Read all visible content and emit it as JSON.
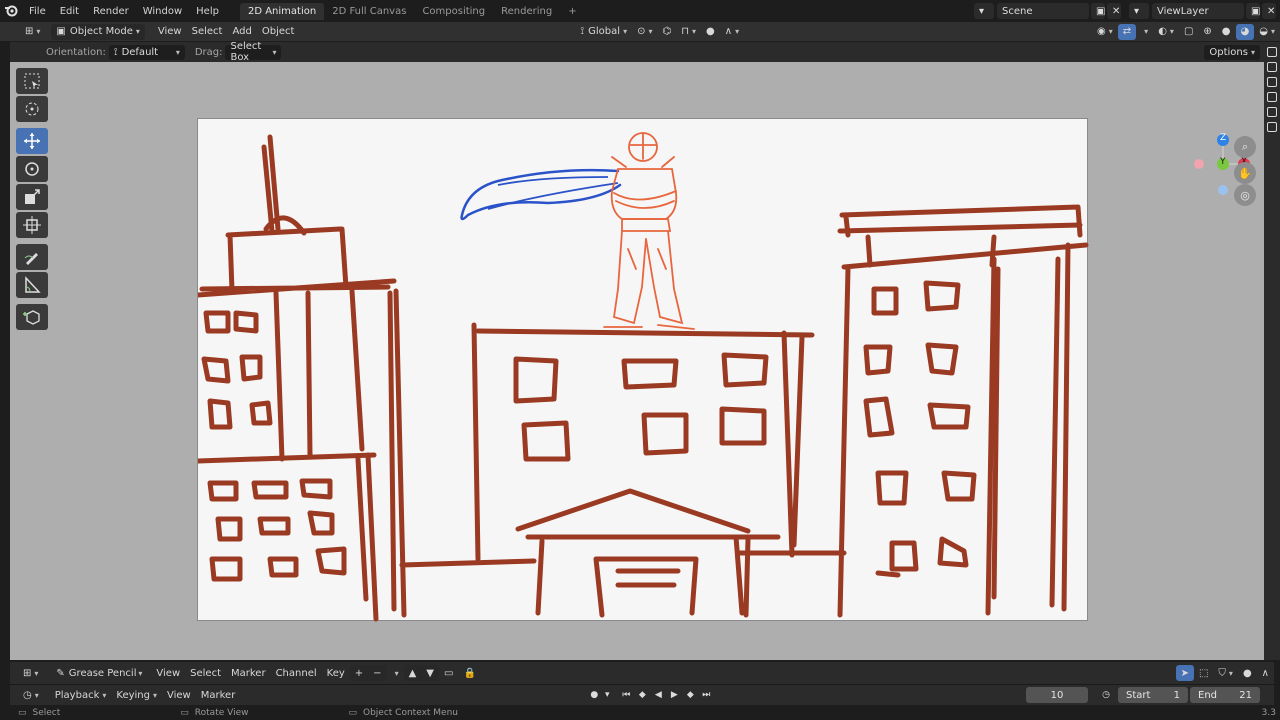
{
  "menu": {
    "file": "File",
    "edit": "Edit",
    "render": "Render",
    "window": "Window",
    "help": "Help"
  },
  "workspaces": [
    "2D Animation",
    "2D Full Canvas",
    "Compositing",
    "Rendering"
  ],
  "workspace_add": "+",
  "scene": {
    "name": "Scene",
    "viewlayer": "ViewLayer"
  },
  "header": {
    "mode": "Object Mode",
    "view": "View",
    "select": "Select",
    "add": "Add",
    "object": "Object",
    "transform": "Global"
  },
  "tool_header": {
    "orientation_label": "Orientation:",
    "orientation_value": "Default",
    "drag_label": "Drag:",
    "drag_value": "Select Box",
    "options": "Options"
  },
  "gizmo": {
    "z": "Z",
    "y": "Y",
    "x": "X"
  },
  "timeline": {
    "editor": "Grease Pencil",
    "view": "View",
    "select": "Select",
    "marker": "Marker",
    "channel": "Channel",
    "key": "Key",
    "playback": "Playback",
    "keying": "Keying",
    "view2": "View",
    "marker2": "Marker",
    "current_frame": "10",
    "start_label": "Start",
    "start_value": "1",
    "end_label": "End",
    "end_value": "21"
  },
  "status": {
    "select": "Select",
    "rotate": "Rotate View",
    "context": "Object Context Menu",
    "version": "3.3"
  },
  "colors": {
    "accent": "#4772b3",
    "sketch_brown": "#9a3a22",
    "sketch_orange": "#e8663e",
    "cape_blue": "#2a52c9"
  }
}
